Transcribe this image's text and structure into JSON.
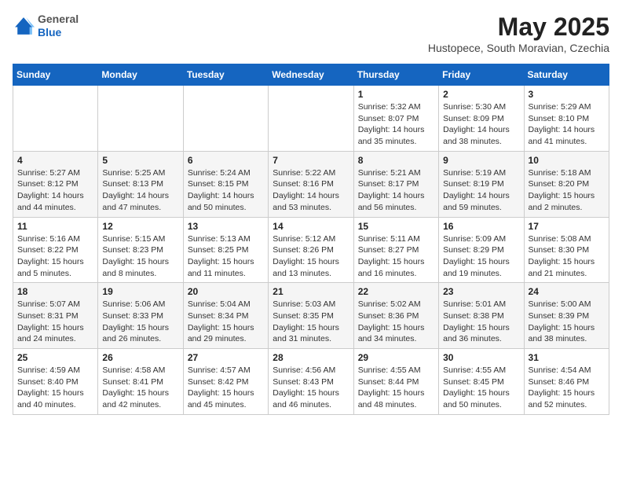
{
  "header": {
    "logo_general": "General",
    "logo_blue": "Blue",
    "month_title": "May 2025",
    "subtitle": "Hustopece, South Moravian, Czechia"
  },
  "weekdays": [
    "Sunday",
    "Monday",
    "Tuesday",
    "Wednesday",
    "Thursday",
    "Friday",
    "Saturday"
  ],
  "weeks": [
    [
      {
        "day": "",
        "info": ""
      },
      {
        "day": "",
        "info": ""
      },
      {
        "day": "",
        "info": ""
      },
      {
        "day": "",
        "info": ""
      },
      {
        "day": "1",
        "info": "Sunrise: 5:32 AM\nSunset: 8:07 PM\nDaylight: 14 hours\nand 35 minutes."
      },
      {
        "day": "2",
        "info": "Sunrise: 5:30 AM\nSunset: 8:09 PM\nDaylight: 14 hours\nand 38 minutes."
      },
      {
        "day": "3",
        "info": "Sunrise: 5:29 AM\nSunset: 8:10 PM\nDaylight: 14 hours\nand 41 minutes."
      }
    ],
    [
      {
        "day": "4",
        "info": "Sunrise: 5:27 AM\nSunset: 8:12 PM\nDaylight: 14 hours\nand 44 minutes."
      },
      {
        "day": "5",
        "info": "Sunrise: 5:25 AM\nSunset: 8:13 PM\nDaylight: 14 hours\nand 47 minutes."
      },
      {
        "day": "6",
        "info": "Sunrise: 5:24 AM\nSunset: 8:15 PM\nDaylight: 14 hours\nand 50 minutes."
      },
      {
        "day": "7",
        "info": "Sunrise: 5:22 AM\nSunset: 8:16 PM\nDaylight: 14 hours\nand 53 minutes."
      },
      {
        "day": "8",
        "info": "Sunrise: 5:21 AM\nSunset: 8:17 PM\nDaylight: 14 hours\nand 56 minutes."
      },
      {
        "day": "9",
        "info": "Sunrise: 5:19 AM\nSunset: 8:19 PM\nDaylight: 14 hours\nand 59 minutes."
      },
      {
        "day": "10",
        "info": "Sunrise: 5:18 AM\nSunset: 8:20 PM\nDaylight: 15 hours\nand 2 minutes."
      }
    ],
    [
      {
        "day": "11",
        "info": "Sunrise: 5:16 AM\nSunset: 8:22 PM\nDaylight: 15 hours\nand 5 minutes."
      },
      {
        "day": "12",
        "info": "Sunrise: 5:15 AM\nSunset: 8:23 PM\nDaylight: 15 hours\nand 8 minutes."
      },
      {
        "day": "13",
        "info": "Sunrise: 5:13 AM\nSunset: 8:25 PM\nDaylight: 15 hours\nand 11 minutes."
      },
      {
        "day": "14",
        "info": "Sunrise: 5:12 AM\nSunset: 8:26 PM\nDaylight: 15 hours\nand 13 minutes."
      },
      {
        "day": "15",
        "info": "Sunrise: 5:11 AM\nSunset: 8:27 PM\nDaylight: 15 hours\nand 16 minutes."
      },
      {
        "day": "16",
        "info": "Sunrise: 5:09 AM\nSunset: 8:29 PM\nDaylight: 15 hours\nand 19 minutes."
      },
      {
        "day": "17",
        "info": "Sunrise: 5:08 AM\nSunset: 8:30 PM\nDaylight: 15 hours\nand 21 minutes."
      }
    ],
    [
      {
        "day": "18",
        "info": "Sunrise: 5:07 AM\nSunset: 8:31 PM\nDaylight: 15 hours\nand 24 minutes."
      },
      {
        "day": "19",
        "info": "Sunrise: 5:06 AM\nSunset: 8:33 PM\nDaylight: 15 hours\nand 26 minutes."
      },
      {
        "day": "20",
        "info": "Sunrise: 5:04 AM\nSunset: 8:34 PM\nDaylight: 15 hours\nand 29 minutes."
      },
      {
        "day": "21",
        "info": "Sunrise: 5:03 AM\nSunset: 8:35 PM\nDaylight: 15 hours\nand 31 minutes."
      },
      {
        "day": "22",
        "info": "Sunrise: 5:02 AM\nSunset: 8:36 PM\nDaylight: 15 hours\nand 34 minutes."
      },
      {
        "day": "23",
        "info": "Sunrise: 5:01 AM\nSunset: 8:38 PM\nDaylight: 15 hours\nand 36 minutes."
      },
      {
        "day": "24",
        "info": "Sunrise: 5:00 AM\nSunset: 8:39 PM\nDaylight: 15 hours\nand 38 minutes."
      }
    ],
    [
      {
        "day": "25",
        "info": "Sunrise: 4:59 AM\nSunset: 8:40 PM\nDaylight: 15 hours\nand 40 minutes."
      },
      {
        "day": "26",
        "info": "Sunrise: 4:58 AM\nSunset: 8:41 PM\nDaylight: 15 hours\nand 42 minutes."
      },
      {
        "day": "27",
        "info": "Sunrise: 4:57 AM\nSunset: 8:42 PM\nDaylight: 15 hours\nand 45 minutes."
      },
      {
        "day": "28",
        "info": "Sunrise: 4:56 AM\nSunset: 8:43 PM\nDaylight: 15 hours\nand 46 minutes."
      },
      {
        "day": "29",
        "info": "Sunrise: 4:55 AM\nSunset: 8:44 PM\nDaylight: 15 hours\nand 48 minutes."
      },
      {
        "day": "30",
        "info": "Sunrise: 4:55 AM\nSunset: 8:45 PM\nDaylight: 15 hours\nand 50 minutes."
      },
      {
        "day": "31",
        "info": "Sunrise: 4:54 AM\nSunset: 8:46 PM\nDaylight: 15 hours\nand 52 minutes."
      }
    ]
  ]
}
